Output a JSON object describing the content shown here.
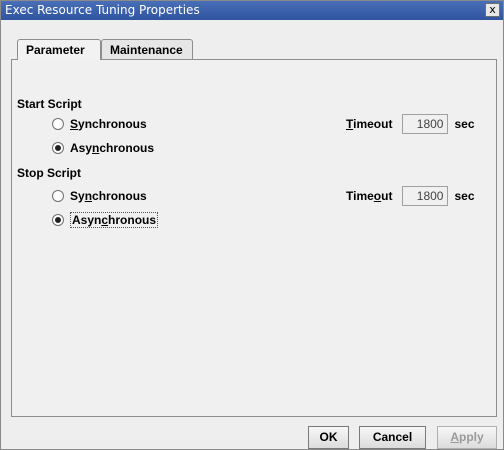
{
  "window": {
    "title": "Exec Resource Tuning Properties",
    "close_label": "x"
  },
  "tabs": [
    {
      "label": "Parameter",
      "active": true
    },
    {
      "label": "Maintenance",
      "active": false
    }
  ],
  "start_script": {
    "label": "Start Script",
    "options": [
      {
        "pre": "",
        "mn": "S",
        "post": "ynchronous",
        "checked": false
      },
      {
        "pre": "Asy",
        "mn": "n",
        "post": "chronous",
        "checked": true
      }
    ],
    "timeout": {
      "pre": "",
      "mn": "T",
      "post": "imeout",
      "value": "1800",
      "unit": "sec"
    }
  },
  "stop_script": {
    "label": "Stop Script",
    "options": [
      {
        "pre": "Sy",
        "mn": "n",
        "post": "chronous",
        "checked": false
      },
      {
        "pre": "Asyn",
        "mn": "c",
        "post": "hronous",
        "checked": true
      }
    ],
    "timeout": {
      "pre": "Time",
      "mn": "o",
      "post": "ut",
      "value": "1800",
      "unit": "sec"
    }
  },
  "buttons": {
    "ok": "OK",
    "cancel": "Cancel",
    "apply_mn": "A",
    "apply_rest": "pply"
  }
}
